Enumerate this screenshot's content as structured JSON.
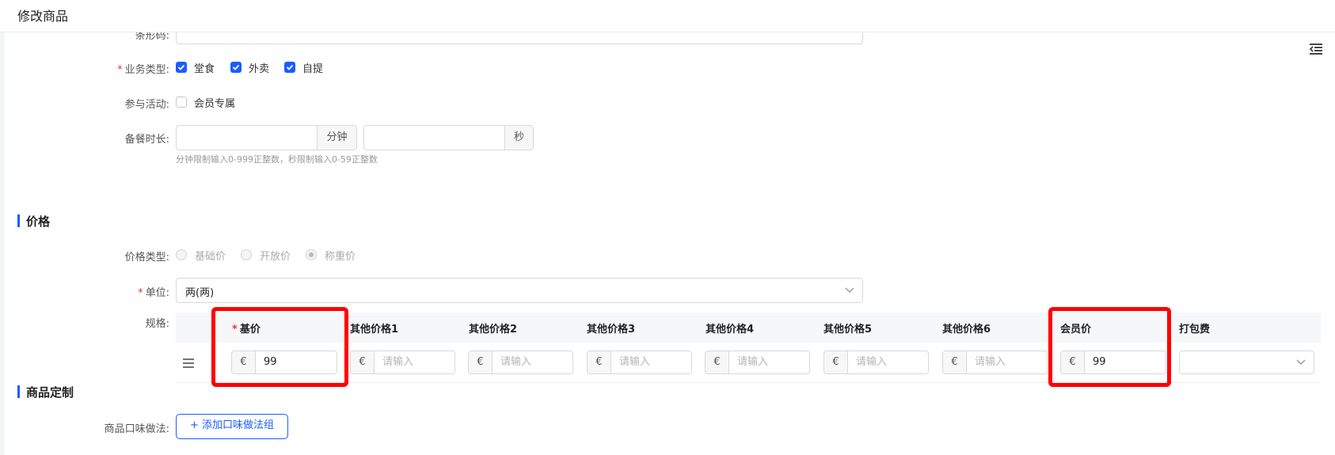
{
  "header": {
    "title": "修改商品"
  },
  "form": {
    "barcode": {
      "label": "条形码:"
    },
    "business_type": {
      "label": "业务类型:",
      "required": "*",
      "options": [
        {
          "label": "堂食",
          "checked": true
        },
        {
          "label": "外卖",
          "checked": true
        },
        {
          "label": "自提",
          "checked": true
        }
      ]
    },
    "activity": {
      "label": "参与活动:",
      "option": "会员专属",
      "checked": false
    },
    "prep_time": {
      "label": "备餐时长:",
      "minute_unit": "分钟",
      "second_unit": "秒",
      "hint": "分钟限制输入0-999正整数，秒限制输入0-59正整数"
    }
  },
  "price_section": {
    "title": "价格",
    "price_type": {
      "label": "价格类型:",
      "options": [
        "基础价",
        "开放价",
        "称重价"
      ],
      "selected": "称重价"
    },
    "unit": {
      "label": "单位:",
      "required": "*",
      "value": "两(两)"
    },
    "spec": {
      "label": "规格:",
      "columns": [
        "基价",
        "其他价格1",
        "其他价格2",
        "其他价格3",
        "其他价格4",
        "其他价格5",
        "其他价格6",
        "会员价",
        "打包费"
      ],
      "currency": "€",
      "placeholder": "请输入",
      "row": {
        "base_price": "99",
        "member_price": "99"
      }
    }
  },
  "custom_section": {
    "title": "商品定制",
    "flavor": {
      "label": "商品口味做法:",
      "button": "+ 添加口味做法组"
    }
  },
  "colors": {
    "accent": "#1a5cff",
    "highlight": "#ff0000",
    "required": "#e53935"
  },
  "icons": [
    "collapse-menu-icon",
    "checkmark-icon",
    "drag-handle-icon",
    "chevron-down-icon"
  ]
}
